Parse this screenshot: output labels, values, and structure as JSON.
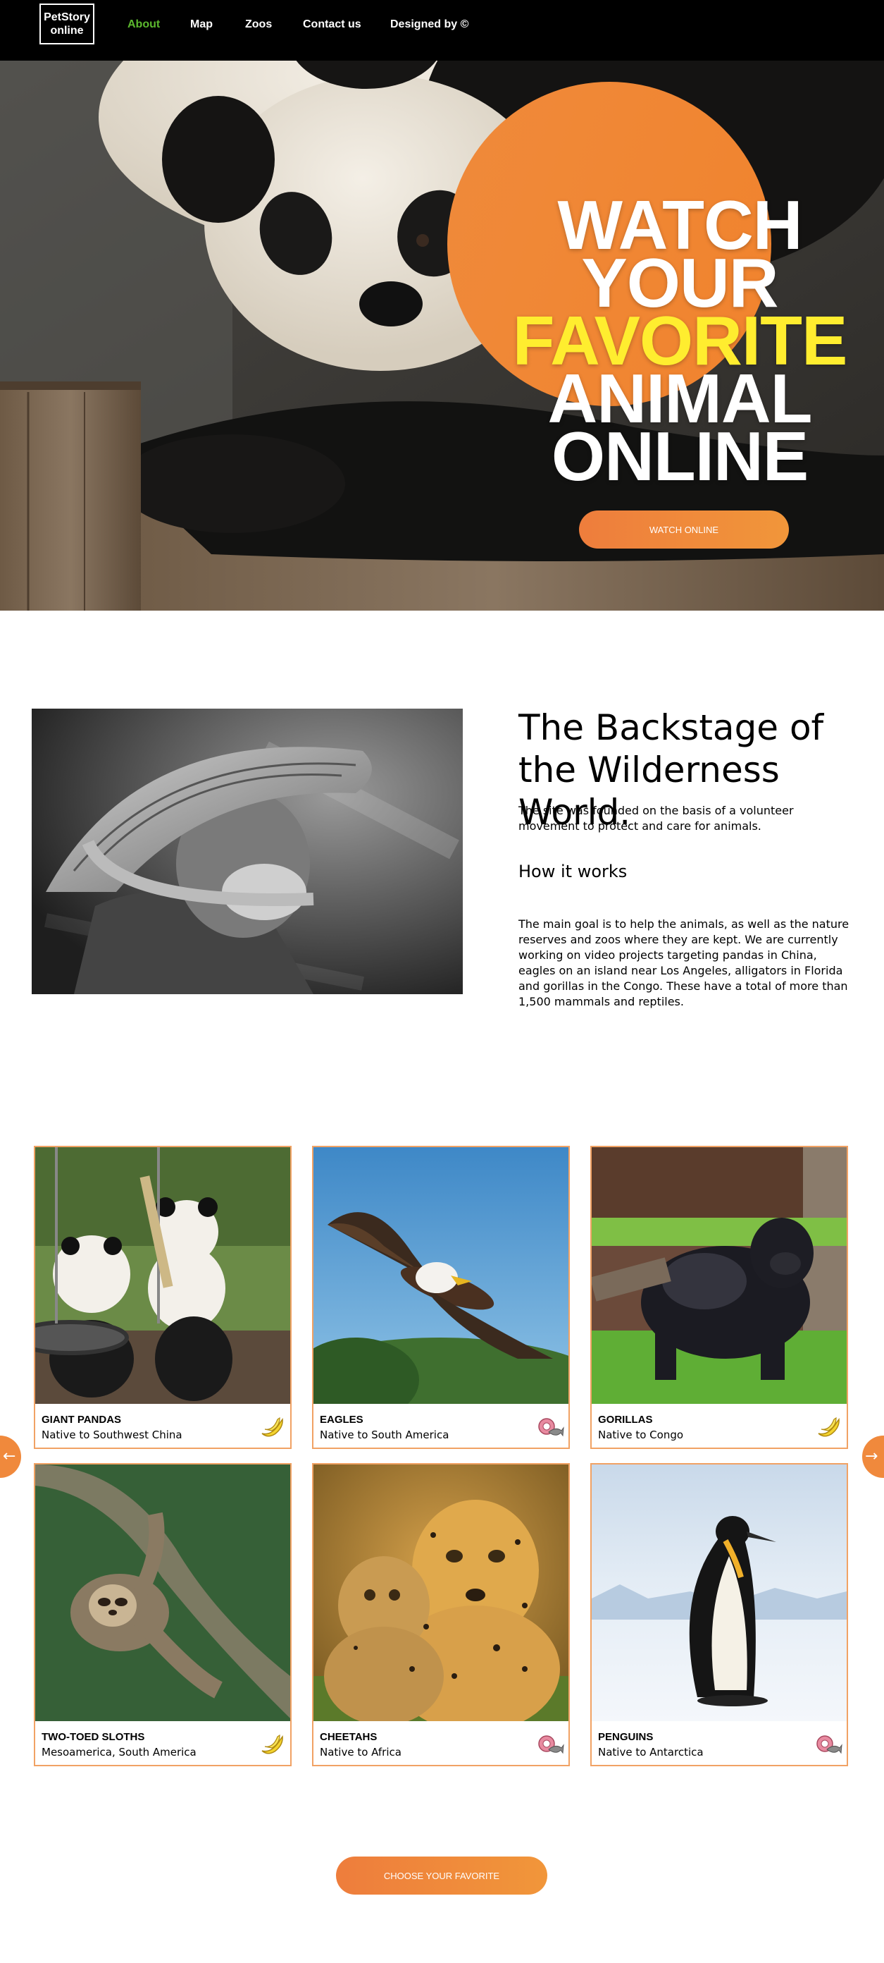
{
  "header": {
    "logo_line1": "PetStory",
    "logo_line2": "online",
    "nav": [
      "About",
      "Map",
      "Zoos",
      "Contact us",
      "Designed by ©"
    ],
    "active_color": "#5cb82e"
  },
  "hero": {
    "title_lines": [
      "WATCH",
      "YOUR",
      "FAVORITE",
      "ANIMAL",
      "ONLINE"
    ],
    "highlight_color": "#ffed2f",
    "button_label": "WATCH ONLINE",
    "accent": "#f0893c"
  },
  "about": {
    "title": "The Backstage of the Wilderness World.",
    "intro": "The site was founded on the basis of a volunteer movement to protect and care for animals.",
    "subtitle": "How it works",
    "body": "The main goal is to help the animals, as well as the nature reserves and zoos where they are kept. We are currently working on video projects targeting pandas in China, eagles on an island near Los Angeles, alligators in Florida and gorillas in the Congo. These have a total of more than 1,500 mammals and reptiles."
  },
  "animals": [
    {
      "name": "GIANT PANDAS",
      "origin": "Native to Southwest China",
      "food_icon": "banana-icon"
    },
    {
      "name": "EAGLES",
      "origin": "Native to South America",
      "food_icon": "meat-fish-icon"
    },
    {
      "name": "GORILLAS",
      "origin": "Native to Congo",
      "food_icon": "banana-icon"
    },
    {
      "name": "TWO-TOED SLOTHS",
      "origin": "Mesoamerica, South America",
      "food_icon": "banana-icon"
    },
    {
      "name": "CHEETAHS",
      "origin": "Native to Africa",
      "food_icon": "meat-fish-icon"
    },
    {
      "name": "PENGUINS",
      "origin": "Native to Antarctica",
      "food_icon": "meat-fish-icon"
    }
  ],
  "carousel": {
    "prev_icon": "arrow-left-icon",
    "next_icon": "arrow-right-icon"
  },
  "cta": {
    "button_label": "CHOOSE YOUR FAVORITE"
  }
}
